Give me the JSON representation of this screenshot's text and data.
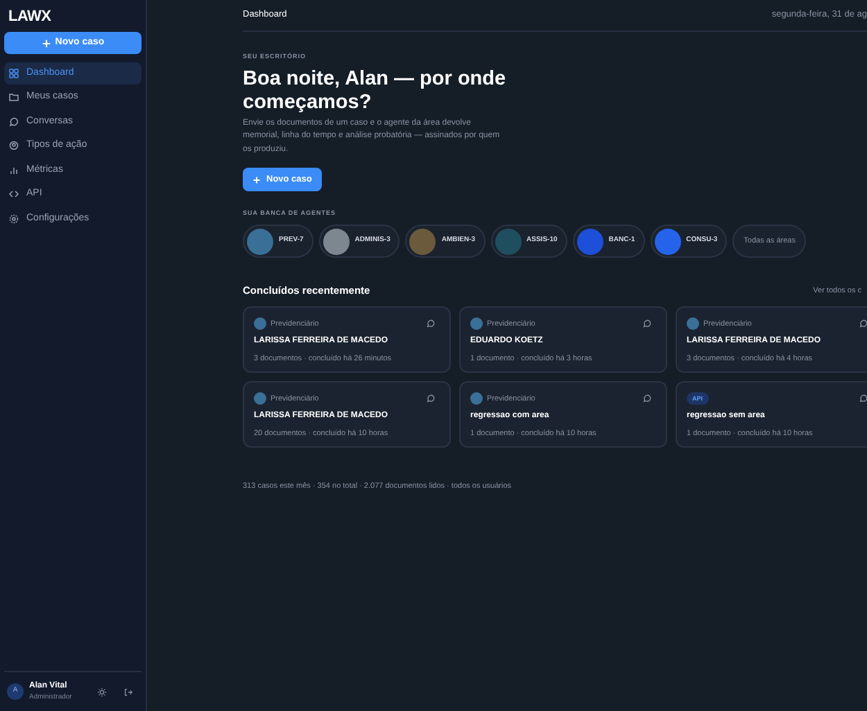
{
  "sidebar": {
    "logo": "LAWX",
    "new_button": "Novo caso",
    "items": [
      {
        "label": "Dashboard",
        "selected": true
      },
      {
        "label": "Meus casos",
        "selected": false
      },
      {
        "label": "Conversas",
        "selected": false
      },
      {
        "label": "Tipos de ação",
        "selected": false
      },
      {
        "label": "Métricas",
        "selected": false
      },
      {
        "label": "API",
        "selected": false
      },
      {
        "label": "Configurações",
        "selected": false
      }
    ],
    "user": {
      "initial": "A",
      "name": "Alan Vital",
      "role": "Administrador"
    }
  },
  "header": {
    "title": "Dashboard",
    "date": "segunda-feira, 31 de ag"
  },
  "hero": {
    "eyebrow": "SEU ESCRITÓRIO",
    "title": "Boa noite, Alan — por onde começamos?",
    "description": "Envie os documentos de um caso e o agente da área devolve memorial, linha do tempo e análise probatória — assinados por quem os produziu.",
    "button": "Novo caso"
  },
  "agents": {
    "title": "SUA BANCA DE AGENTES",
    "items": [
      {
        "name": "PREV-7",
        "color": "#3a6f98"
      },
      {
        "name": "ADMINIS-3",
        "color": "#7d8790"
      },
      {
        "name": "AMBIEN-3",
        "color": "#6b5a3c"
      },
      {
        "name": "ASSIS-10",
        "color": "#1f4f5e"
      },
      {
        "name": "BANC-1",
        "color": "#1d4fd8"
      },
      {
        "name": "CONSU-3",
        "color": "#2563eb"
      }
    ],
    "all": "Todas as áreas"
  },
  "recent": {
    "title": "Concluídos recentemente",
    "link": "Ver todos os c",
    "cards": [
      {
        "tag": {
          "kind": "agent",
          "label": "Previdenciário"
        },
        "name": "LARISSA FERREIRA DE MACEDO",
        "meta": "3 documentos · concluído há 26 minutos"
      },
      {
        "tag": {
          "kind": "agent",
          "label": "Previdenciário"
        },
        "name": "EDUARDO KOETZ",
        "meta": "1 documento · concluído há 3 horas"
      },
      {
        "tag": {
          "kind": "agent",
          "label": "Previdenciário"
        },
        "name": "LARISSA FERREIRA DE MACEDO",
        "meta": "3 documentos · concluído há 4 horas"
      },
      {
        "tag": {
          "kind": "agent",
          "label": "Previdenciário"
        },
        "name": "LARISSA FERREIRA DE MACEDO",
        "meta": "20 documentos · concluído há 10 horas"
      },
      {
        "tag": {
          "kind": "agent",
          "label": "Previdenciário"
        },
        "name": "regressao com area",
        "meta": "1 documento · concluído há 10 horas"
      },
      {
        "tag": {
          "kind": "api",
          "label": "API"
        },
        "name": "regressao sem area",
        "meta": "1 documento · concluído há 10 horas"
      }
    ]
  },
  "footer_stats": "313 casos este mês · 354 no total · 2.077 documentos lidos · todos os usuários"
}
